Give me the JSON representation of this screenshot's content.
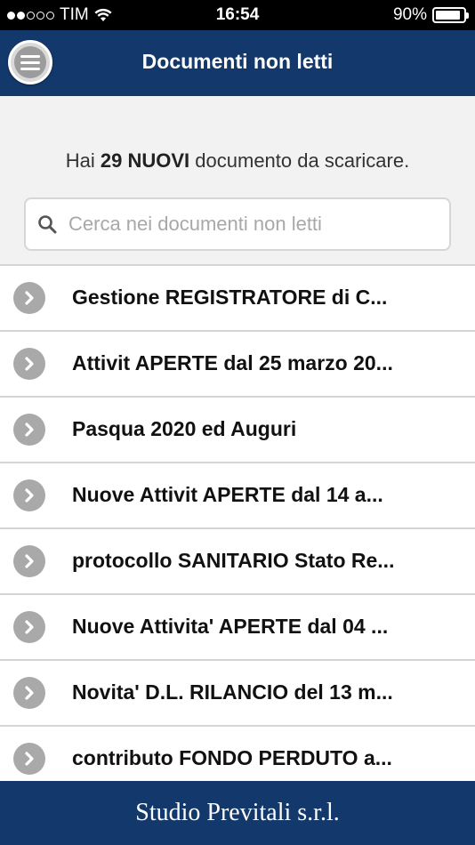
{
  "status_bar": {
    "carrier": "TIM",
    "time": "16:54",
    "battery_percent": "90%",
    "battery_level": 0.9,
    "signal_bars_filled": 2,
    "signal_bars_total": 5
  },
  "nav": {
    "title": "Documenti non letti",
    "menu_icon": "hamburger-menu-icon"
  },
  "intro": {
    "prefix": "Hai ",
    "count_text": "29 NUOVI",
    "suffix": " documento da scaricare."
  },
  "search": {
    "placeholder": "Cerca nei documenti non letti",
    "value": "",
    "icon": "search-icon"
  },
  "documents": [
    {
      "label": "Gestione REGISTRATORE di C..."
    },
    {
      "label": "Attivit APERTE dal 25 marzo 20..."
    },
    {
      "label": "Pasqua 2020 ed Auguri"
    },
    {
      "label": "Nuove Attivit APERTE dal 14 a..."
    },
    {
      "label": "protocollo SANITARIO Stato Re..."
    },
    {
      "label": "Nuove Attivita' APERTE dal 04 ..."
    },
    {
      "label": "Novita' D.L. RILANCIO del 13 m..."
    },
    {
      "label": "contributo FONDO PERDUTO a..."
    }
  ],
  "footer": {
    "text": "Studio Previtali s.r.l."
  },
  "colors": {
    "nav_background": "#13386b",
    "chevron_background": "#a9a9a9",
    "list_background": "#ffffff",
    "page_background": "#f2f2f2"
  }
}
